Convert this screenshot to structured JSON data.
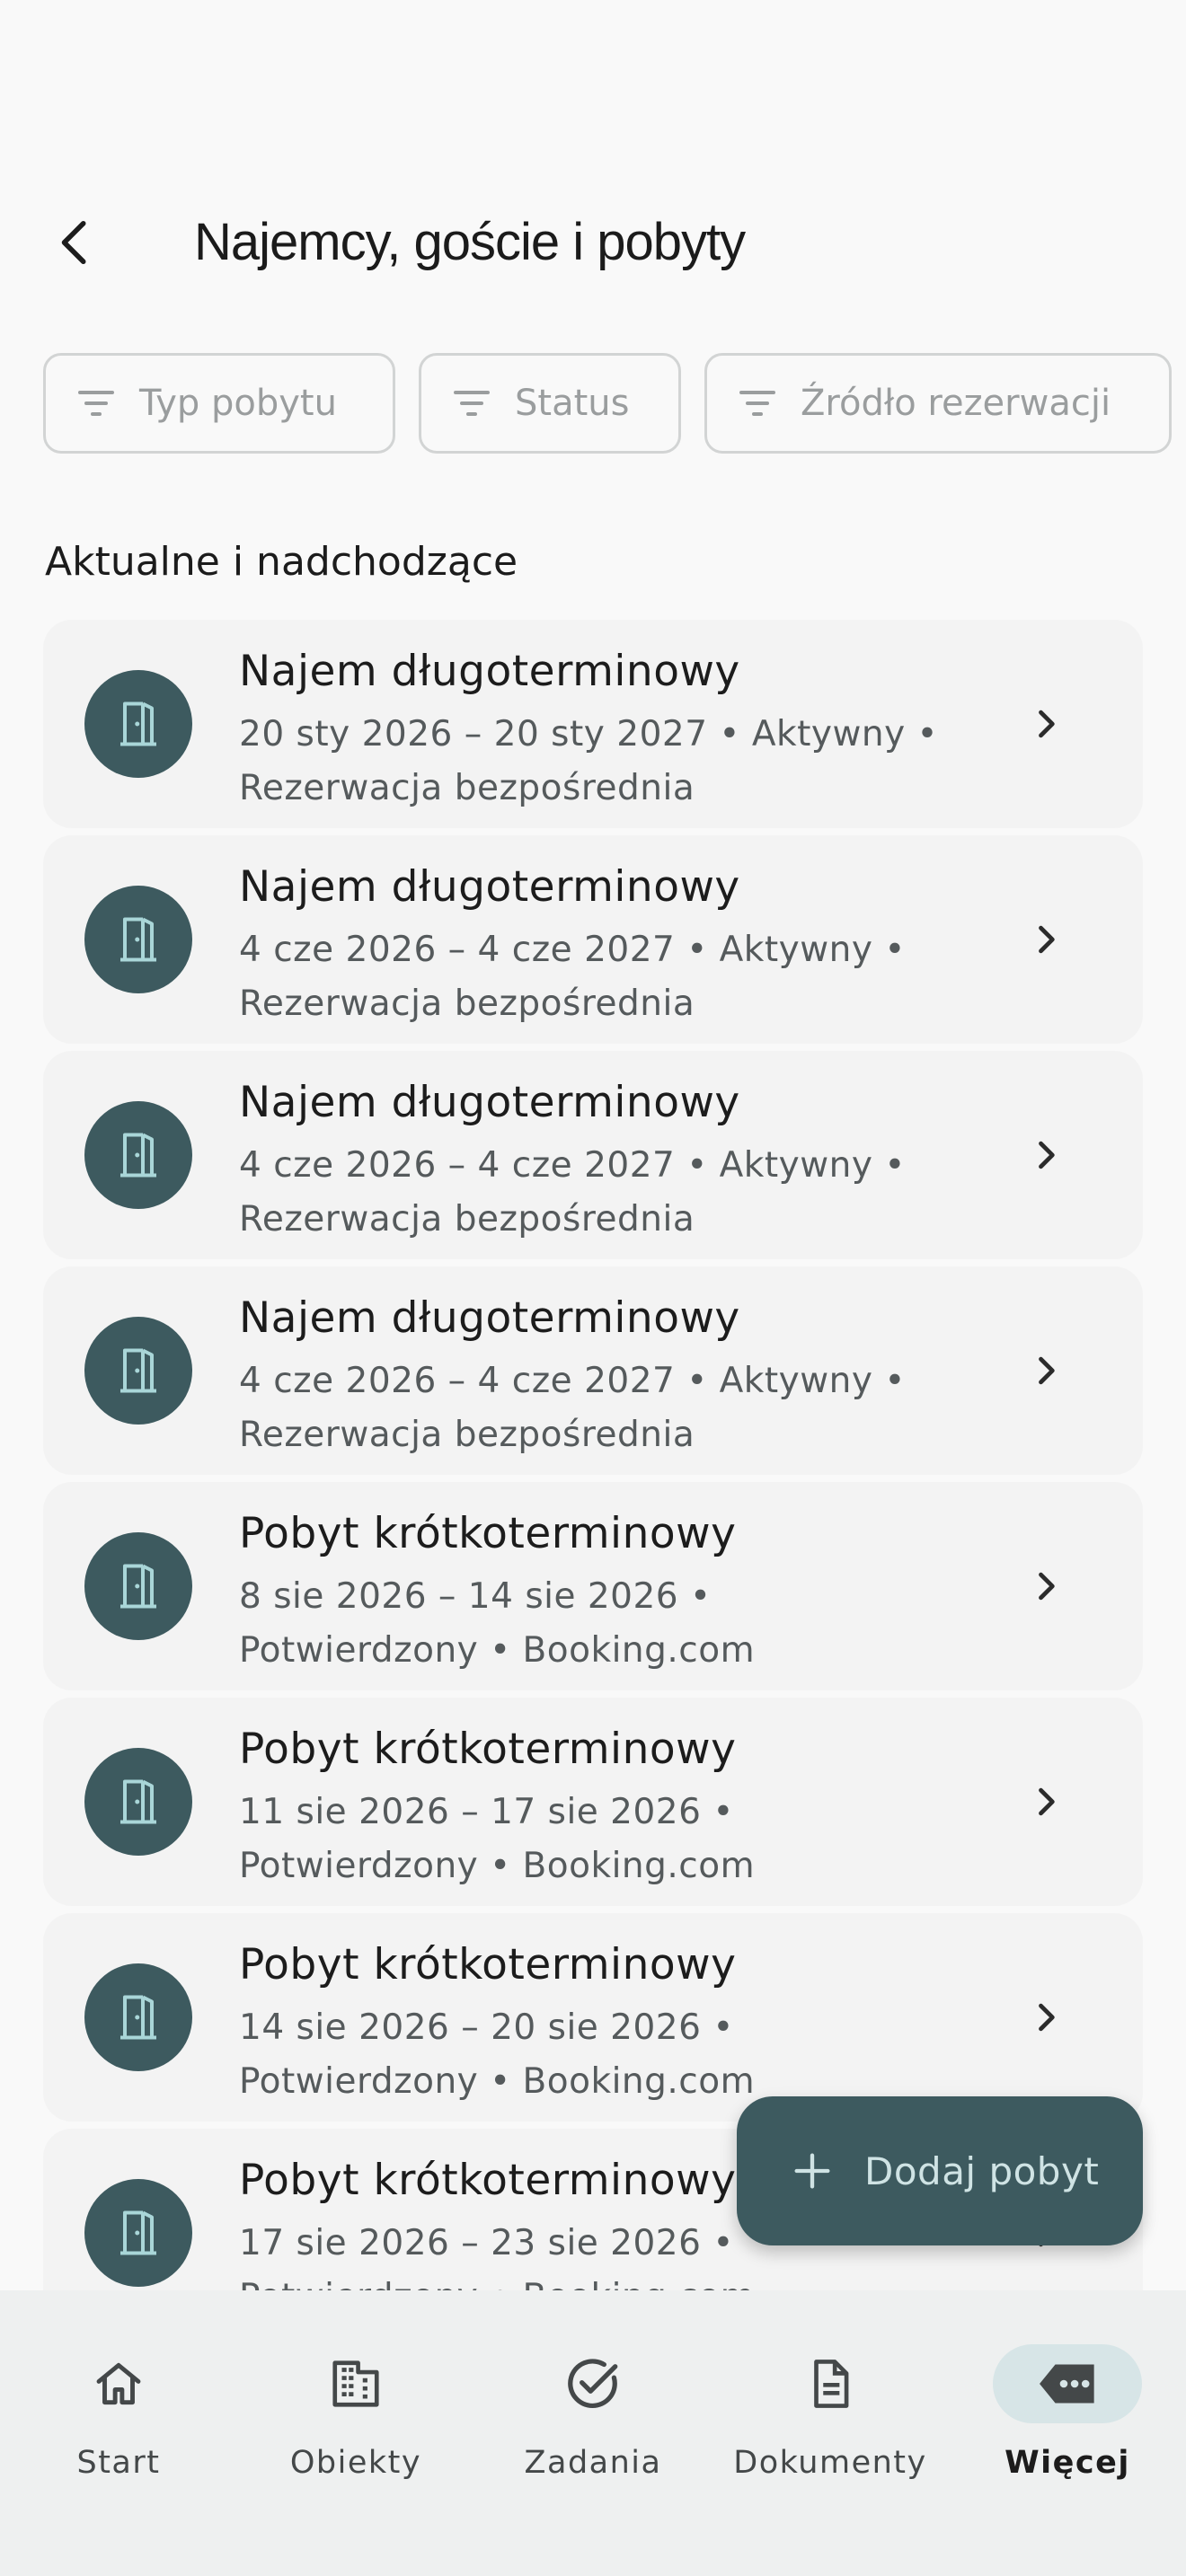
{
  "header": {
    "title": "Najemcy, goście i pobyty",
    "back_icon": "arrow-back-icon"
  },
  "filters": [
    {
      "label": "Typ pobytu",
      "icon": "filter-icon"
    },
    {
      "label": "Status",
      "icon": "filter-icon"
    },
    {
      "label": "Źródło rezerwacji",
      "icon": "filter-icon"
    }
  ],
  "section": {
    "title": "Aktualne i nadchodzące"
  },
  "stays": [
    {
      "title": "Najem długoterminowy",
      "line1": "20 sty 2026 – 20 sty 2027 • Aktywny •",
      "line2": "Rezerwacja bezpośrednia"
    },
    {
      "title": "Najem długoterminowy",
      "line1": "4 cze 2026 – 4 cze 2027 • Aktywny •",
      "line2": "Rezerwacja bezpośrednia"
    },
    {
      "title": "Najem długoterminowy",
      "line1": "4 cze 2026 – 4 cze 2027 • Aktywny •",
      "line2": "Rezerwacja bezpośrednia"
    },
    {
      "title": "Najem długoterminowy",
      "line1": "4 cze 2026 – 4 cze 2027 • Aktywny •",
      "line2": "Rezerwacja bezpośrednia"
    },
    {
      "title": "Pobyt krótkoterminowy",
      "line1": "8 sie 2026 – 14 sie 2026 •",
      "line2": "Potwierdzony • Booking.com"
    },
    {
      "title": "Pobyt krótkoterminowy",
      "line1": "11 sie 2026 – 17 sie 2026 •",
      "line2": "Potwierdzony • Booking.com"
    },
    {
      "title": "Pobyt krótkoterminowy",
      "line1": "14 sie 2026 – 20 sie 2026 •",
      "line2": "Potwierdzony • Booking.com"
    },
    {
      "title": "Pobyt krótkoterminowy",
      "line1": "17 sie 2026 – 23 sie 2026 •",
      "line2": "Potwierdzony • Booking.com"
    }
  ],
  "fab": {
    "label": "Dodaj pobyt",
    "icon": "plus-icon"
  },
  "nav": [
    {
      "label": "Start",
      "icon": "home-icon",
      "active": false
    },
    {
      "label": "Obiekty",
      "icon": "building-icon",
      "active": false
    },
    {
      "label": "Zadania",
      "icon": "check-circle-icon",
      "active": false
    },
    {
      "label": "Dokumenty",
      "icon": "document-icon",
      "active": false
    },
    {
      "label": "Więcej",
      "icon": "more-icon",
      "active": true
    }
  ],
  "colors": {
    "accent": "#3d5a5f",
    "accent_light": "#d7e5e7",
    "icon_tint": "#a9d6d8"
  }
}
